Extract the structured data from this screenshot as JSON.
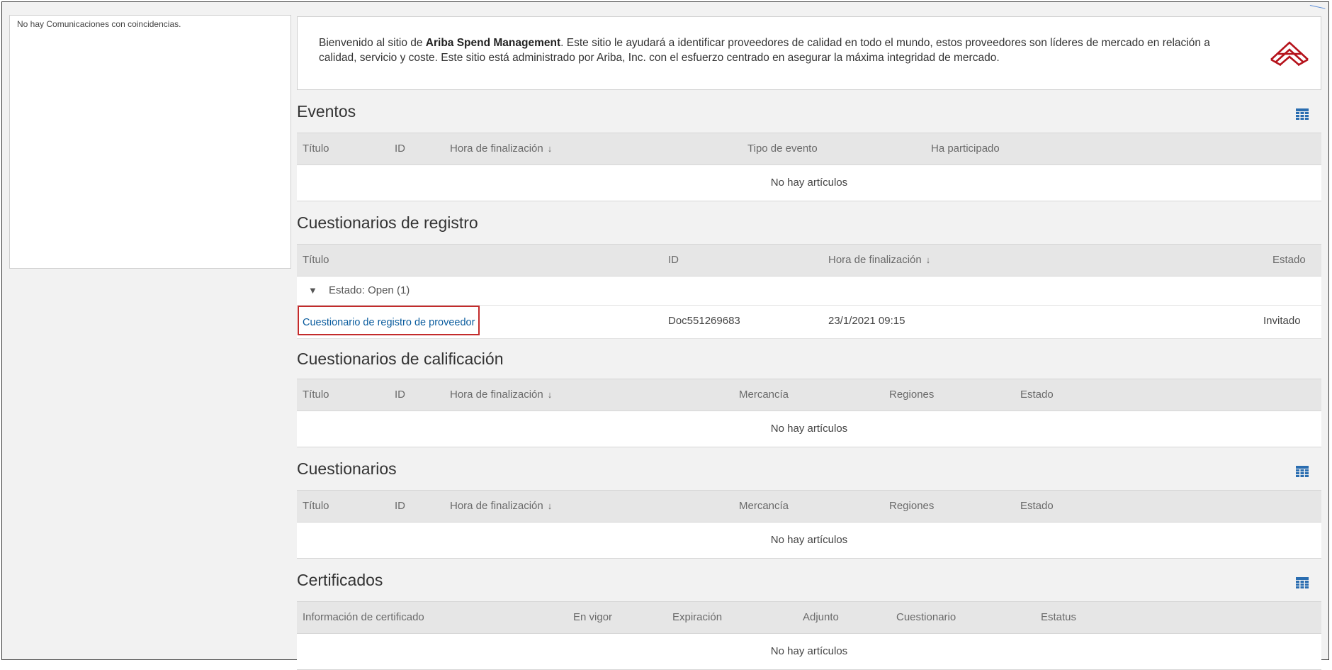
{
  "side_panel": {
    "message": "No hay Comunicaciones con coincidencias."
  },
  "welcome": {
    "prefix": "Bienvenido al sitio de ",
    "brand": "Ariba Spend Management",
    "suffix": ". Este sitio le ayudará a identificar proveedores de calidad en todo el mundo, estos proveedores son líderes de mercado en relación a calidad, servicio y coste. Este sitio está administrado por Ariba, Inc. con el esfuerzo centrado en asegurar la máxima integridad de mercado.",
    "logo_icon": "ariba-logo-icon"
  },
  "sort_arrow": "↓",
  "eventos": {
    "title": "Eventos",
    "columns": [
      "Título",
      "ID",
      "Hora de finalización",
      "Tipo de evento",
      "Ha participado"
    ],
    "empty": "No hay artículos"
  },
  "registro": {
    "title": "Cuestionarios de registro",
    "columns": [
      "Título",
      "ID",
      "Hora de finalización",
      "Estado"
    ],
    "group_toggle": "▼",
    "group_label": "Estado: Open",
    "group_count": "(1)",
    "row": {
      "title": "Cuestionario de registro de proveedor",
      "id": "Doc551269683",
      "end_time": "23/1/2021 09:15",
      "status": "Invitado"
    }
  },
  "calificacion": {
    "title": "Cuestionarios de calificación",
    "columns": [
      "Título",
      "ID",
      "Hora de finalización",
      "Mercancía",
      "Regiones",
      "Estado"
    ],
    "empty": "No hay artículos"
  },
  "cuestionarios": {
    "title": "Cuestionarios",
    "columns": [
      "Título",
      "ID",
      "Hora de finalización",
      "Mercancía",
      "Regiones",
      "Estado"
    ],
    "empty": "No hay artículos"
  },
  "certificados": {
    "title": "Certificados",
    "columns": [
      "Información de certificado",
      "En vigor",
      "Expiración",
      "Adjunto",
      "Cuestionario",
      "Estatus"
    ],
    "empty": "No hay artículos"
  },
  "colors": {
    "accent": "#0a5c9e",
    "highlight": "#c32b2b",
    "grid_icon": "#2a6db0"
  }
}
